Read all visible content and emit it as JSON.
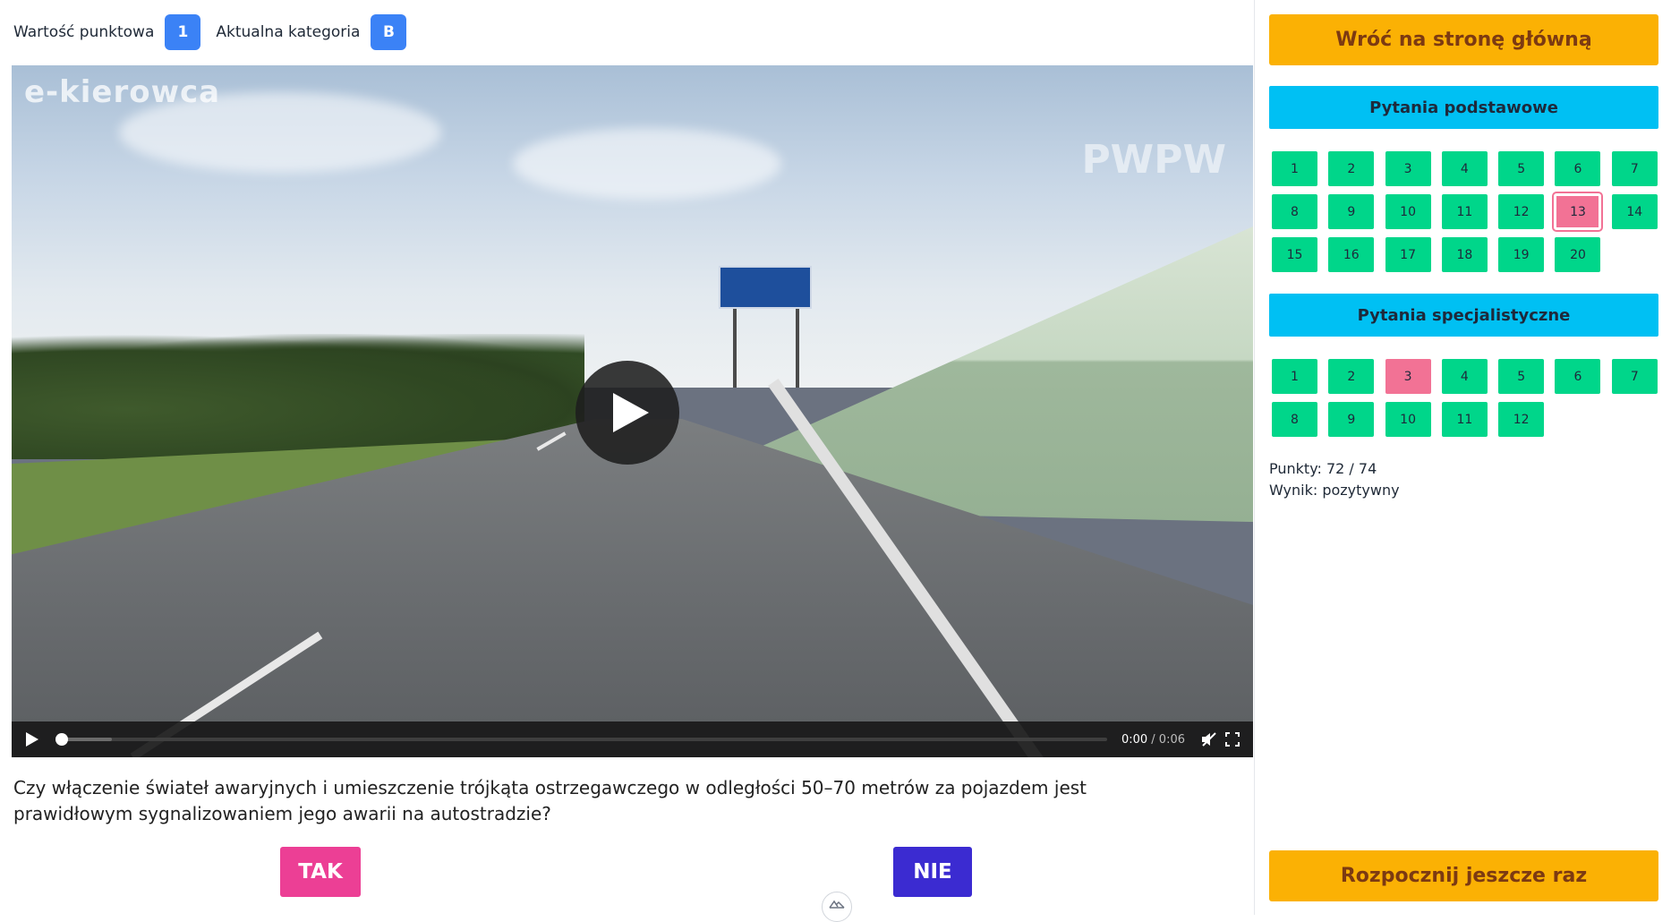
{
  "topbar": {
    "points_label": "Wartość punktowa",
    "points_value": "1",
    "category_label": "Aktualna kategoria",
    "category_value": "B"
  },
  "video": {
    "watermark_left": "e-kierowca",
    "watermark_right": "PWPW",
    "current_time": "0:00",
    "separator": " / ",
    "duration": "0:06",
    "progress": 0
  },
  "question": {
    "text": "Czy włączenie świateł awaryjnych i umieszczenie trójkąta ostrzegawczego w odległości 50–70 metrów za pojazdem jest prawidłowym sygnalizowaniem jego awarii na autostradzie?",
    "answer_yes": "TAK",
    "answer_no": "NIE"
  },
  "sidebar": {
    "home_button": "Wróć na stronę główną",
    "basic_heading": "Pytania podstawowe",
    "basic_questions": [
      {
        "n": "1",
        "state": "correct"
      },
      {
        "n": "2",
        "state": "correct"
      },
      {
        "n": "3",
        "state": "correct"
      },
      {
        "n": "4",
        "state": "correct"
      },
      {
        "n": "5",
        "state": "correct"
      },
      {
        "n": "6",
        "state": "correct"
      },
      {
        "n": "7",
        "state": "correct"
      },
      {
        "n": "8",
        "state": "correct"
      },
      {
        "n": "9",
        "state": "correct"
      },
      {
        "n": "10",
        "state": "correct"
      },
      {
        "n": "11",
        "state": "correct"
      },
      {
        "n": "12",
        "state": "correct"
      },
      {
        "n": "13",
        "state": "current"
      },
      {
        "n": "14",
        "state": "correct"
      },
      {
        "n": "15",
        "state": "correct"
      },
      {
        "n": "16",
        "state": "correct"
      },
      {
        "n": "17",
        "state": "correct"
      },
      {
        "n": "18",
        "state": "correct"
      },
      {
        "n": "19",
        "state": "correct"
      },
      {
        "n": "20",
        "state": "correct"
      }
    ],
    "special_heading": "Pytania specjalistyczne",
    "special_questions": [
      {
        "n": "1",
        "state": "correct"
      },
      {
        "n": "2",
        "state": "correct"
      },
      {
        "n": "3",
        "state": "wrong"
      },
      {
        "n": "4",
        "state": "correct"
      },
      {
        "n": "5",
        "state": "correct"
      },
      {
        "n": "6",
        "state": "correct"
      },
      {
        "n": "7",
        "state": "correct"
      },
      {
        "n": "8",
        "state": "correct"
      },
      {
        "n": "9",
        "state": "correct"
      },
      {
        "n": "10",
        "state": "correct"
      },
      {
        "n": "11",
        "state": "correct"
      },
      {
        "n": "12",
        "state": "correct"
      }
    ],
    "score_line": "Punkty: 72 / 74",
    "result_line": "Wynik: pozytywny",
    "restart_button": "Rozpocznij jeszcze raz"
  },
  "colors": {
    "badge": "#3b82f6",
    "correct": "#00d68a",
    "wrong": "#f27295",
    "section_header": "#00c0f3",
    "action_button": "#fbb104",
    "answer_yes": "#ec3f95",
    "answer_no": "#3b2bd1"
  }
}
